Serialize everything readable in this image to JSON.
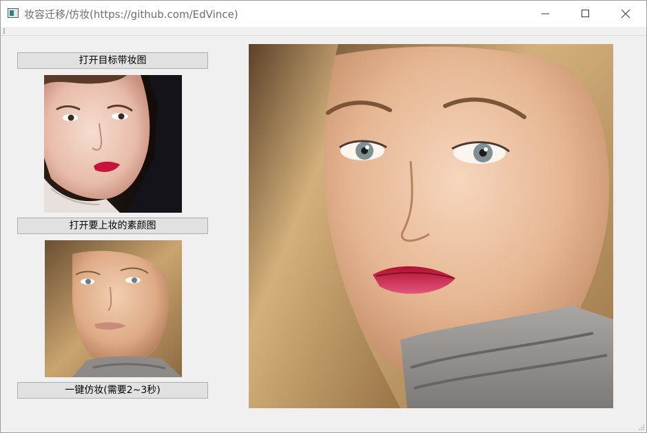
{
  "window": {
    "title": "妆容迁移/仿妆(https://github.com/EdVince)"
  },
  "titlebar_buttons": {
    "minimize_icon": "minimize-icon",
    "maximize_icon": "maximize-icon",
    "close_icon": "close-icon"
  },
  "controls": {
    "open_target_label": "打开目标带妆图",
    "open_source_label": "打开要上妆的素颜图",
    "transfer_label": "一键仿妆(需要2~3秒)"
  },
  "images": {
    "target_makeup": "target-makeup-portrait",
    "source_bare": "bare-face-portrait",
    "result": "makeup-result-portrait"
  },
  "colors": {
    "button_bg": "#e1e1e1",
    "button_border": "#adadad",
    "window_bg": "#f0f0f0",
    "lip_red": "#c8143c"
  }
}
